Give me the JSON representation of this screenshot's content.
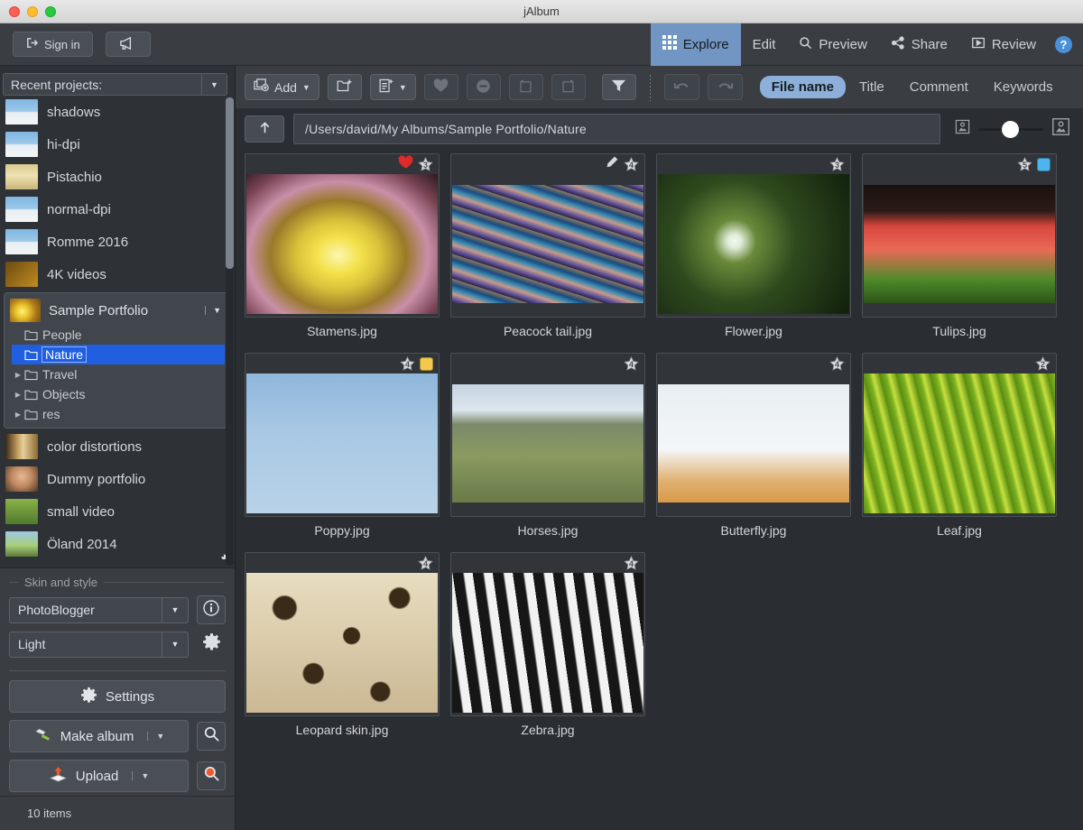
{
  "window": {
    "title": "jAlbum"
  },
  "topbar": {
    "signin_label": "Sign in",
    "signin_icon": "sign-in-icon",
    "announce_icon": "megaphone-icon",
    "tabs": [
      {
        "label": "Explore",
        "icon": "grid-icon",
        "active": true
      },
      {
        "label": "Edit",
        "icon": "",
        "active": false
      },
      {
        "label": "Preview",
        "icon": "search-icon",
        "active": false
      },
      {
        "label": "Share",
        "icon": "share-icon",
        "active": false
      },
      {
        "label": "Review",
        "icon": "play-icon",
        "active": false
      }
    ],
    "help_label": "?",
    "active_tab_color": "#7196c4",
    "help_color": "#4a90d9"
  },
  "sidebar": {
    "recent_projects_label": "Recent projects:",
    "projects": [
      {
        "label": "shadows",
        "thumb": "people-snow"
      },
      {
        "label": "hi-dpi",
        "thumb": "people-snow"
      },
      {
        "label": "Pistachio",
        "thumb": "pasta"
      },
      {
        "label": "normal-dpi",
        "thumb": "people-snow"
      },
      {
        "label": "Romme 2016",
        "thumb": "people-snow"
      },
      {
        "label": "4K videos",
        "thumb": "video"
      }
    ],
    "tree": {
      "root_label": "Sample Portfolio",
      "root_thumb": "flower-yellow",
      "items": [
        {
          "label": "People",
          "expandable": false,
          "selected": false
        },
        {
          "label": "Nature",
          "expandable": false,
          "selected": true
        },
        {
          "label": "Travel",
          "expandable": true,
          "selected": false
        },
        {
          "label": "Objects",
          "expandable": true,
          "selected": false
        },
        {
          "label": "res",
          "expandable": true,
          "selected": false
        }
      ],
      "selection_color": "#1f5fe0"
    },
    "projects_after": [
      {
        "label": "color distortions",
        "thumb": "wood"
      },
      {
        "label": "Dummy portfolio",
        "thumb": "portrait"
      },
      {
        "label": "small video",
        "thumb": "video-green"
      },
      {
        "label": "Öland 2014",
        "thumb": "landscape"
      }
    ]
  },
  "skin_panel": {
    "group_label": "Skin and style",
    "skin_value": "PhotoBlogger",
    "style_value": "Light",
    "info_icon": "info-icon",
    "gear_icon": "gear-icon",
    "settings_label": "Settings",
    "settings_icon": "gear-icon",
    "make_album_label": "Make album",
    "make_album_icon": "hammer-icon",
    "upload_label": "Upload",
    "upload_icon": "upload-icon",
    "browse_local_icon": "magnifier-icon",
    "browse_online_icon": "magnifier-orange-icon"
  },
  "statusbar": {
    "items_count": "10 items"
  },
  "toolbar": {
    "add_label": "Add",
    "add_icon": "add-image-icon",
    "new_folder_icon": "new-folder-icon",
    "new_page_icon": "new-page-icon",
    "favorite_icon": "heart-icon",
    "exclude_icon": "minus-circle-icon",
    "rotate_left_icon": "rotate-left-icon",
    "rotate_right_icon": "rotate-right-icon",
    "filter_icon": "funnel-icon",
    "undo_icon": "undo-icon",
    "redo_icon": "redo-icon",
    "sort_modes": [
      {
        "label": "File name",
        "active": true
      },
      {
        "label": "Title",
        "active": false
      },
      {
        "label": "Comment",
        "active": false
      },
      {
        "label": "Keywords",
        "active": false
      }
    ],
    "sort_active_color": "#8cb0da"
  },
  "pathbar": {
    "up_icon": "arrow-up-folder-icon",
    "path": "/Users/david/My Albums/Sample Portfolio/Nature",
    "zoom_small_icon": "small-thumb-icon",
    "zoom_large_icon": "large-thumb-icon",
    "zoom_value": 38
  },
  "grid": {
    "items": [
      {
        "name": "Stamens.jpg",
        "rating": "3",
        "favorite": true,
        "edited": false,
        "color_label": null,
        "art": "stamens"
      },
      {
        "name": "Peacock tail.jpg",
        "rating": "4",
        "favorite": false,
        "edited": true,
        "color_label": null,
        "art": "peacock"
      },
      {
        "name": "Flower.jpg",
        "rating": "3",
        "favorite": false,
        "edited": false,
        "color_label": null,
        "art": "flower"
      },
      {
        "name": "Tulips.jpg",
        "rating": "5",
        "favorite": false,
        "edited": false,
        "color_label": "#4db4ed",
        "art": "tulips"
      },
      {
        "name": "Poppy.jpg",
        "rating": "4",
        "favorite": false,
        "edited": false,
        "color_label": "#f2c council",
        "art": "poppy"
      },
      {
        "name": "Horses.jpg",
        "rating": "4",
        "favorite": false,
        "edited": false,
        "color_label": null,
        "art": "horses"
      },
      {
        "name": "Butterfly.jpg",
        "rating": "4",
        "favorite": false,
        "edited": false,
        "color_label": null,
        "art": "butterfly"
      },
      {
        "name": "Leaf.jpg",
        "rating": "2",
        "favorite": false,
        "edited": false,
        "color_label": null,
        "art": "leaf"
      },
      {
        "name": "Leopard skin.jpg",
        "rating": "4",
        "favorite": false,
        "edited": false,
        "color_label": null,
        "art": "leopard"
      },
      {
        "name": "Zebra.jpg",
        "rating": "4",
        "favorite": false,
        "edited": false,
        "color_label": null,
        "art": "zebra"
      }
    ]
  }
}
